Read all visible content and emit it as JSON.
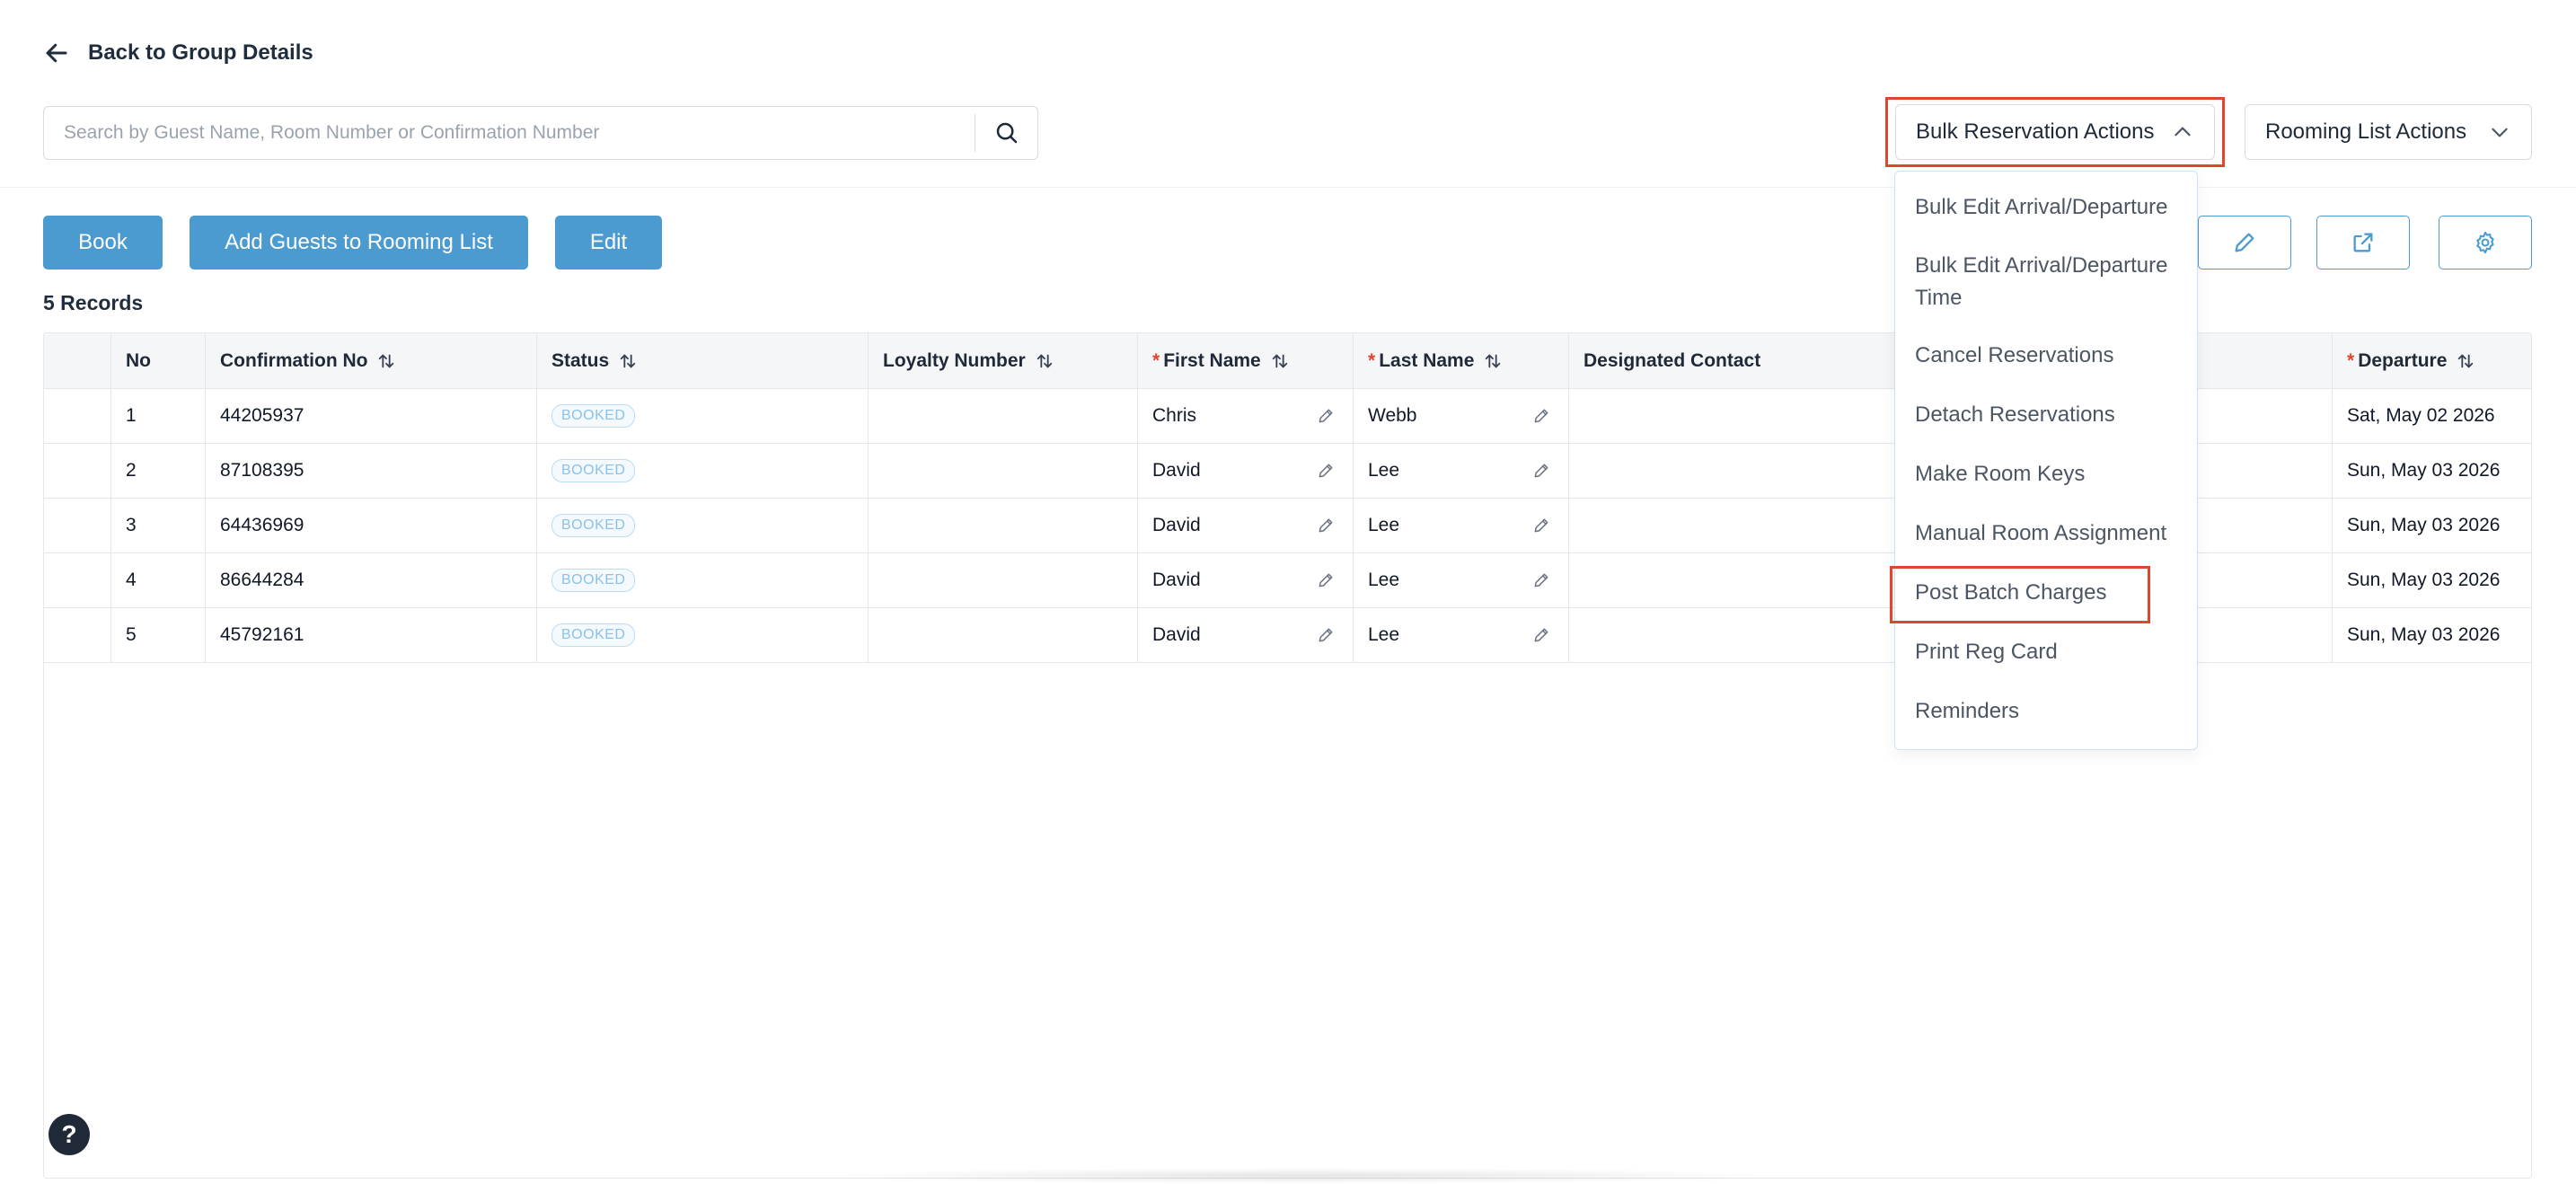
{
  "nav": {
    "back_label": "Back to Group Details"
  },
  "search": {
    "placeholder": "Search by Guest Name, Room Number or Confirmation Number"
  },
  "actions": {
    "bulk_label": "Bulk Reservation Actions",
    "rooming_label": "Rooming List Actions",
    "book_label": "Book",
    "add_guests_label": "Add Guests to Rooming List",
    "edit_label": "Edit"
  },
  "records_label": "5 Records",
  "table": {
    "headers": {
      "no": "No",
      "confirmation": "Confirmation No",
      "status": "Status",
      "loyalty": "Loyalty Number",
      "first_name": "First Name",
      "last_name": "Last Name",
      "designated_contact": "Designated Contact",
      "departure": "Departure"
    },
    "required_marker": "*",
    "rows": [
      {
        "no": "1",
        "confirmation": "44205937",
        "status": "BOOKED",
        "first_name": "Chris",
        "last_name": "Webb",
        "departure": "Sat, May 02 2026"
      },
      {
        "no": "2",
        "confirmation": "87108395",
        "status": "BOOKED",
        "first_name": "David",
        "last_name": "Lee",
        "departure": "Sun, May 03 2026"
      },
      {
        "no": "3",
        "confirmation": "64436969",
        "status": "BOOKED",
        "first_name": "David",
        "last_name": "Lee",
        "departure": "Sun, May 03 2026"
      },
      {
        "no": "4",
        "confirmation": "86644284",
        "status": "BOOKED",
        "first_name": "David",
        "last_name": "Lee",
        "departure": "Sun, May 03 2026"
      },
      {
        "no": "5",
        "confirmation": "45792161",
        "status": "BOOKED",
        "first_name": "David",
        "last_name": "Lee",
        "departure": "Sun, May 03 2026"
      }
    ]
  },
  "bulk_menu": {
    "items": [
      "Bulk Edit Arrival/Departure",
      "Bulk Edit Arrival/Departure Time",
      "Cancel Reservations",
      "Detach Reservations",
      "Make Room Keys",
      "Manual Room Assignment",
      "Post Batch Charges",
      "Print Reg Card",
      "Reminders"
    ]
  },
  "help_label": "?",
  "colors": {
    "primary": "#4b9bd1",
    "highlight": "#e2452d",
    "badge_text": "#8cc2e8",
    "header_bg": "#f5f6f8"
  },
  "icons": {
    "back": "arrow-left-icon",
    "search": "search-icon",
    "chevron_up": "chevron-up-icon",
    "chevron_down": "chevron-down-icon",
    "pencil": "pencil-icon",
    "external": "external-link-icon",
    "gear": "gear-icon",
    "sort": "sort-icon",
    "help": "help-icon"
  }
}
